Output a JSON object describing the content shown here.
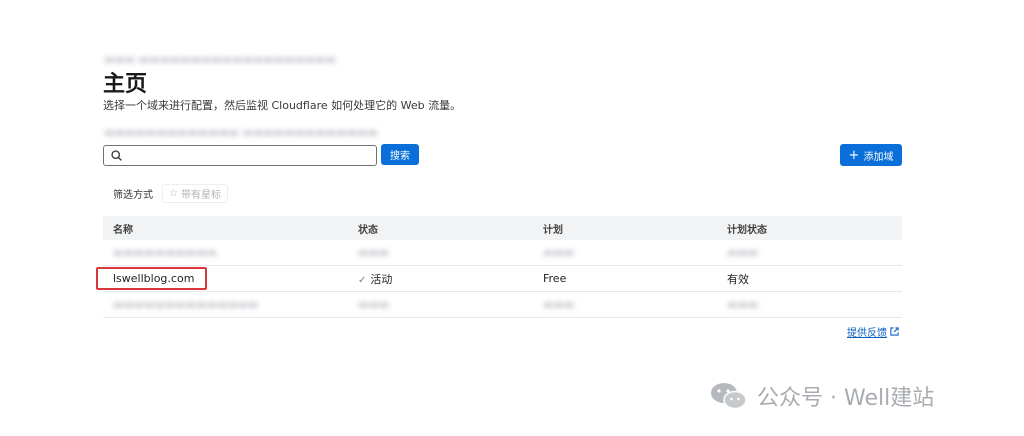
{
  "header": {
    "blurred_top": "▬▬▬ ▬▬▬▬▬▬▬▬▬▬▬▬▬▬▬▬▬▬▬",
    "title": "主页",
    "description": "选择一个域来进行配置，然后监视 Cloudflare 如何处理它的 Web 流量。",
    "blurred_sub": "▬▬▬▬▬▬▬▬▬▬▬▬▬ ▬▬▬▬▬▬▬▬▬▬▬▬▬"
  },
  "search": {
    "value": "",
    "placeholder": "",
    "button_label": "搜索"
  },
  "add_domain": {
    "label": "添加域"
  },
  "filter": {
    "label": "筛选方式",
    "starred_label": "带有星标"
  },
  "table": {
    "columns": [
      "名称",
      "状态",
      "计划",
      "计划状态"
    ],
    "rows": [
      {
        "name": "▬▬▬▬▬▬▬▬▬▬",
        "status": "▬▬▬",
        "plan": "▬▬▬",
        "plan_status": "▬▬▬"
      },
      {
        "name": "lswellblog.com",
        "status": "活动",
        "plan": "Free",
        "plan_status": "有效"
      },
      {
        "name": "▬▬▬▬▬▬▬▬▬▬▬▬▬▬",
        "status": "▬▬▬",
        "plan": "▬▬▬",
        "plan_status": "▬▬▬"
      }
    ]
  },
  "feedback": {
    "label": "提供反馈"
  },
  "watermark": {
    "text": "公众号 · Well建站"
  },
  "colors": {
    "accent": "#0a6fd8",
    "highlight": "#d8373d",
    "link": "#0a5fbf"
  },
  "icons": {
    "search": "search-icon",
    "plus": "plus-icon",
    "star": "star-icon",
    "check": "check-icon",
    "external": "external-link-icon",
    "wechat": "wechat-icon"
  }
}
